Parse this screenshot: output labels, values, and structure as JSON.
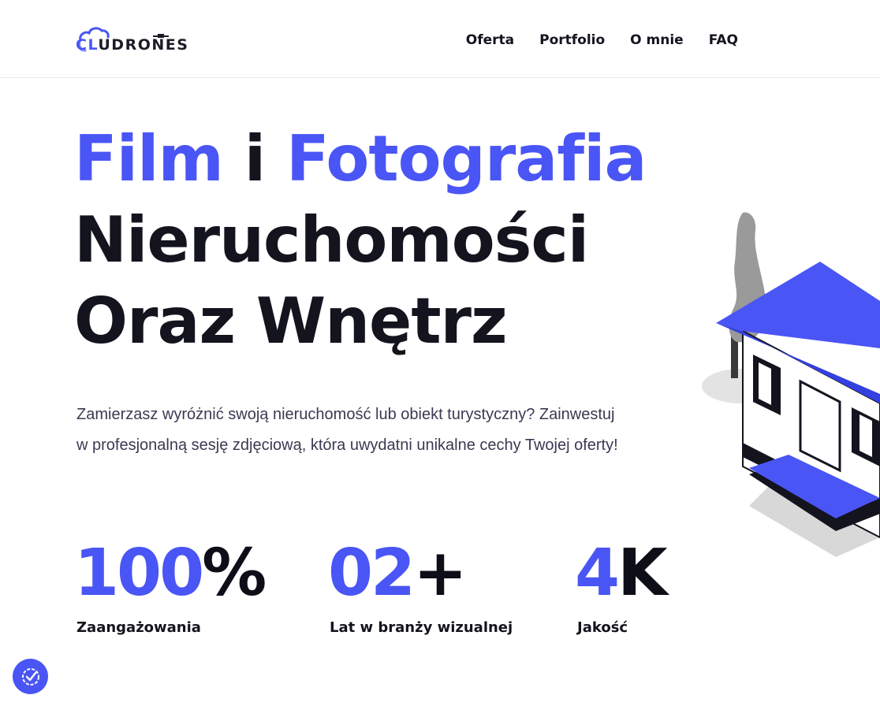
{
  "header": {
    "logo_text_c": "CL",
    "logo_text_rest": "UDRONES",
    "nav": [
      "Oferta",
      "Portfolio",
      "O mnie",
      "FAQ"
    ]
  },
  "hero": {
    "line1_a": "Film",
    "line1_b": " i ",
    "line1_c": "Fotografia",
    "line2": "Nieruchomości",
    "line3": "Oraz Wnętrz",
    "description": "Zamierzasz wyróżnić swoją nieruchomość lub obiekt turystyczny? Zainwestuj w profesjonalną sesję zdjęciową, która uwydatni unikalne cechy Twojej oferty!"
  },
  "stats": [
    {
      "value": "100",
      "suffix": "%",
      "label": "Zaangażowania"
    },
    {
      "value": "02",
      "suffix": "+",
      "label": "Lat w branży wizualnej"
    },
    {
      "value": "4",
      "suffix": "K",
      "label": "Jakość"
    }
  ],
  "colors": {
    "accent": "#4a55f5",
    "text": "#14141f",
    "body_text": "#3a3a52"
  },
  "icons": {
    "fab": "badge-check-icon",
    "drone": "drone-icon"
  }
}
